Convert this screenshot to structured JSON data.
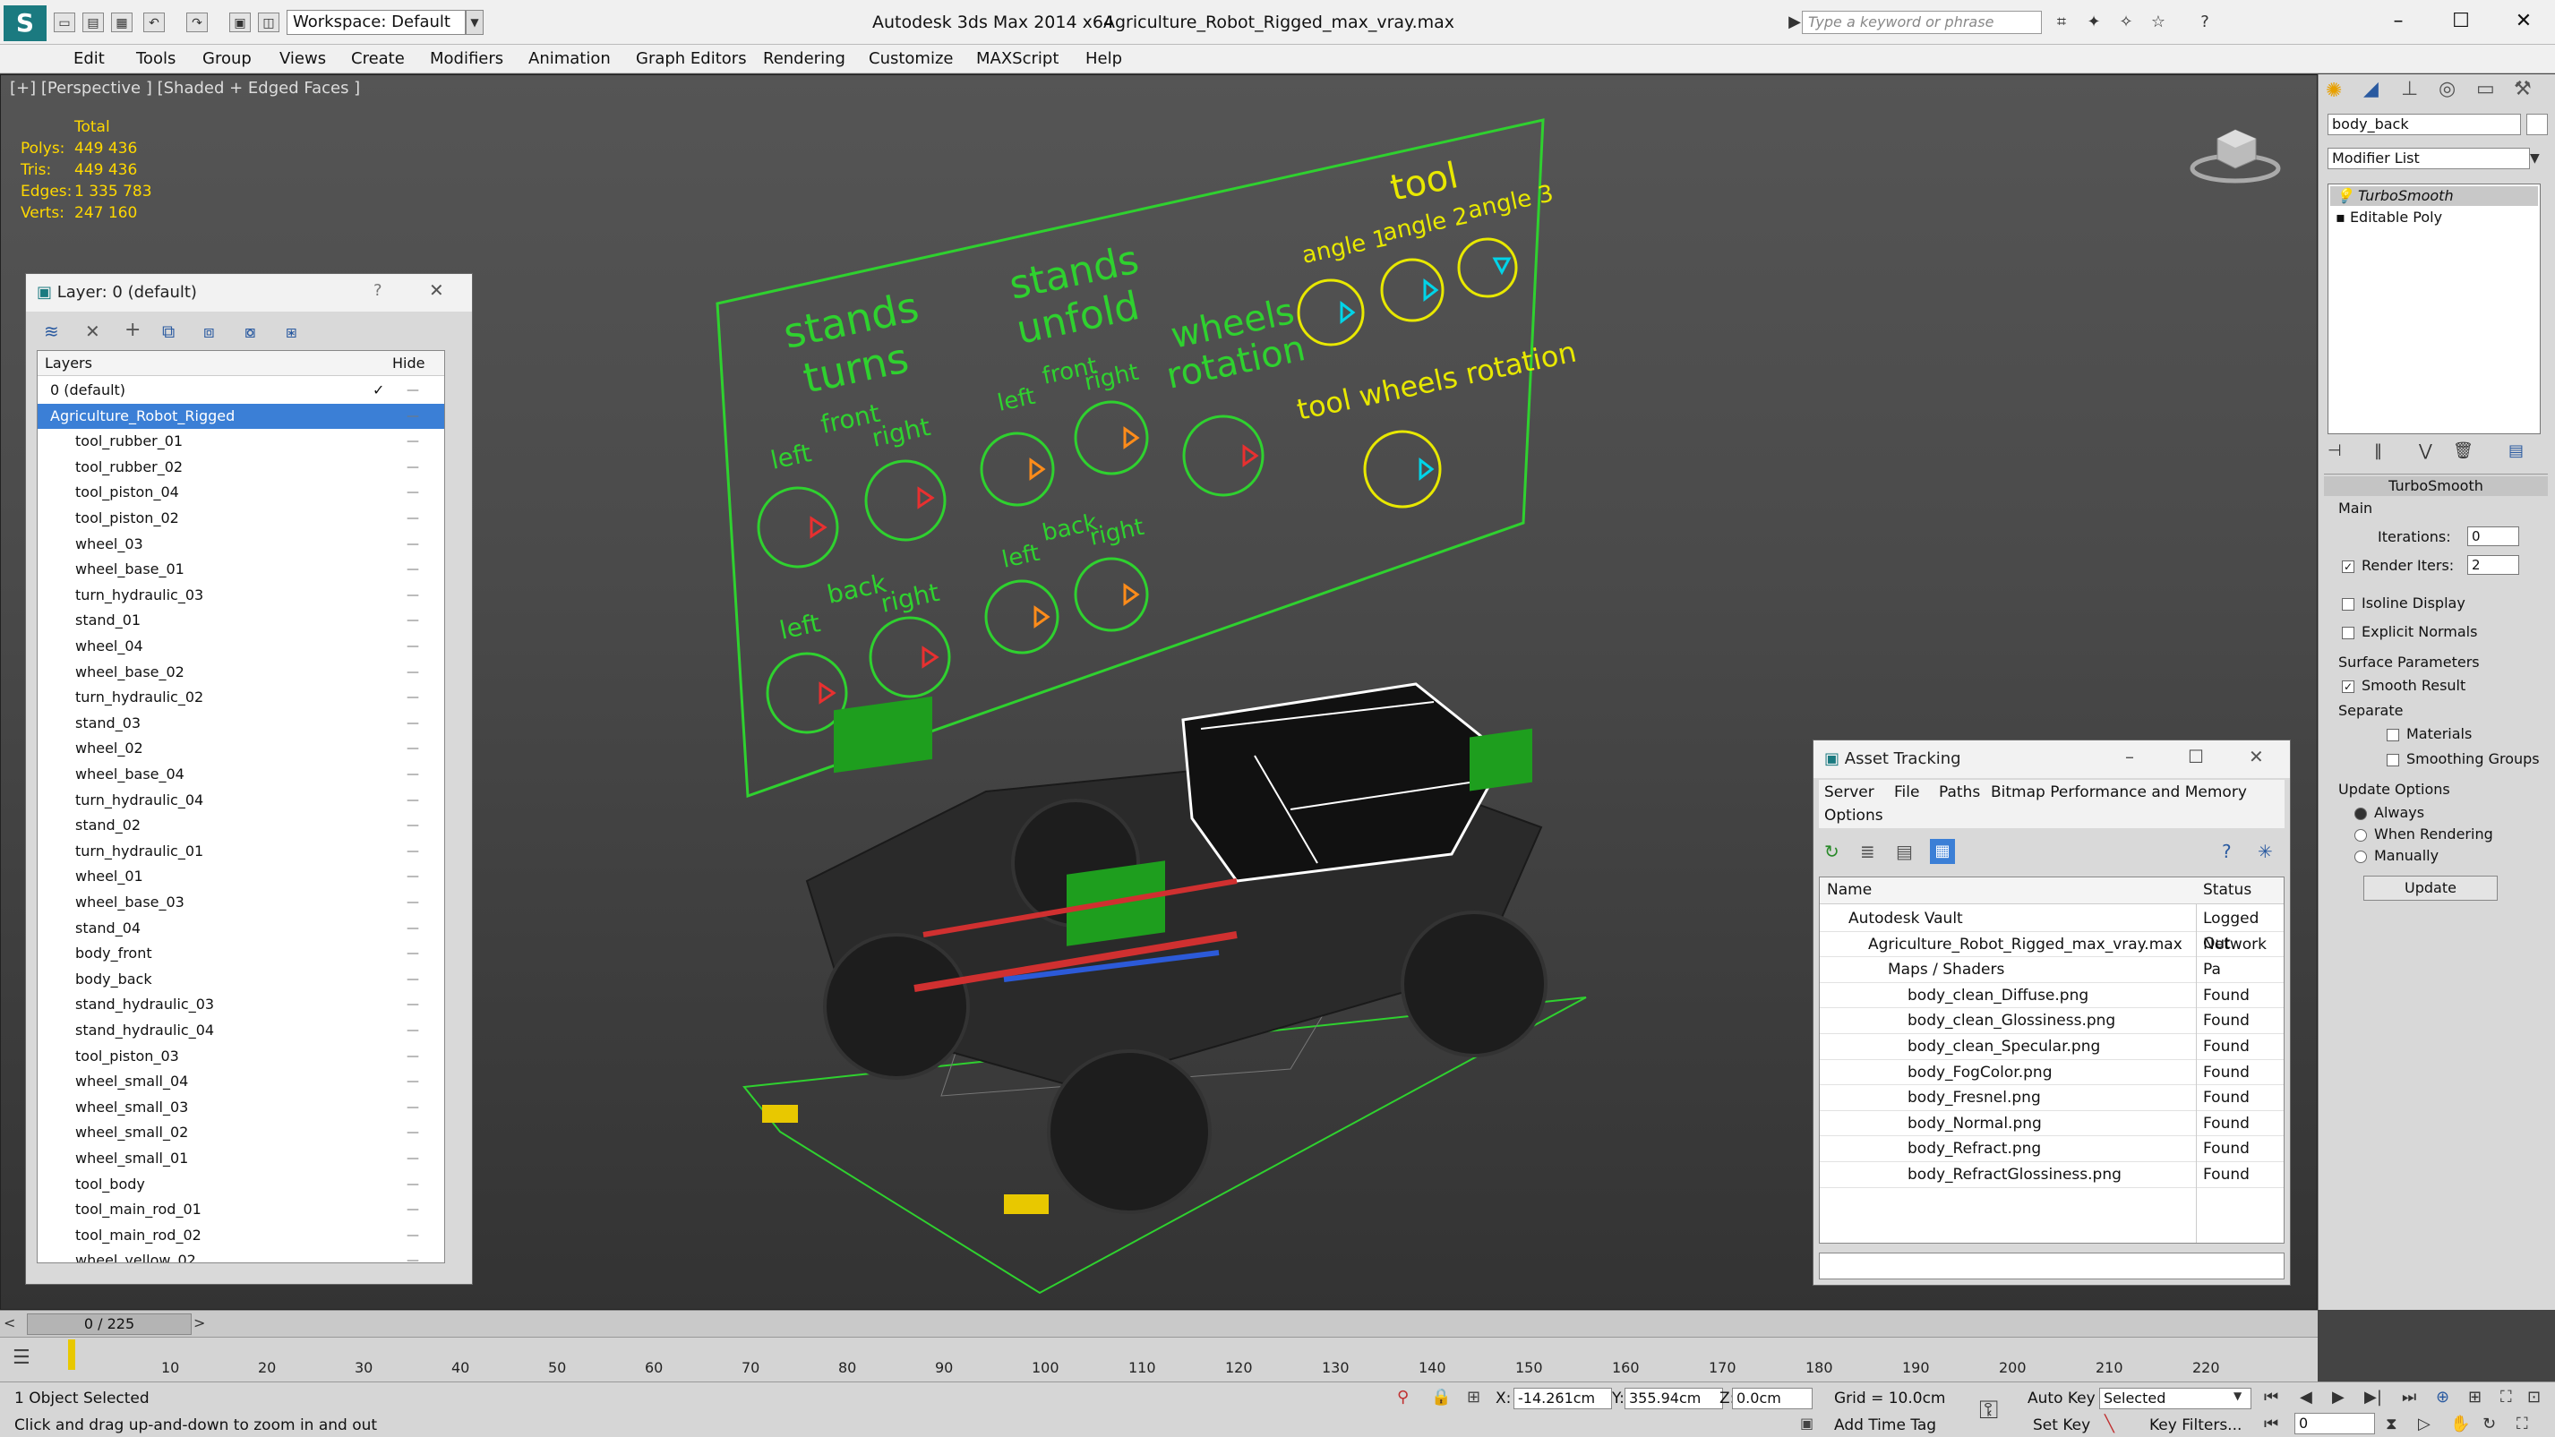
{
  "app": {
    "title": "Autodesk 3ds Max  2014 x64",
    "file": "Agriculture_Robot_Rigged_max_vray.max",
    "workspace": "Workspace: Default",
    "search_placeholder": "Type a keyword or phrase"
  },
  "menu": [
    "Edit",
    "Tools",
    "Group",
    "Views",
    "Create",
    "Modifiers",
    "Animation",
    "Graph Editors",
    "Rendering",
    "Customize",
    "MAXScript",
    "Help"
  ],
  "viewport": {
    "label": "[+] [Perspective ] [Shaded + Edged Faces ]",
    "stats": {
      "total": "Total",
      "rows": [
        {
          "label": "Polys:",
          "value": "449 436"
        },
        {
          "label": "Tris:",
          "value": "449 436"
        },
        {
          "label": "Edges:",
          "value": "1 335 783"
        },
        {
          "label": "Verts:",
          "value": "247 160"
        }
      ]
    },
    "board_labels": {
      "stands_turns_1": "stands",
      "stands_turns_2": "turns",
      "front": "front",
      "left_1": "left",
      "right_1": "right",
      "back": "back",
      "left_2": "left",
      "right_2": "right",
      "stands_unfold_1": "stands",
      "stands_unfold_2": "unfold",
      "front_2": "front",
      "left_3": "left",
      "right_3": "right",
      "back_2": "back",
      "left_4": "left",
      "right_4": "right",
      "wheels_1": "wheels",
      "wheels_2": "rotation",
      "tool": "tool",
      "angle1": "angle 1",
      "angle2": "angle 2",
      "angle3": "angle 3",
      "tool_wheels": "tool wheels rotation"
    },
    "colors": {
      "green": "#2fd12f",
      "yellow": "#e8e800",
      "cyan": "#00d4e8",
      "orange": "#ff8c1a",
      "red": "#e83030"
    }
  },
  "layers": {
    "title": "Layer: 0 (default)",
    "question": "?",
    "col_layers": "Layers",
    "col_hide": "Hide",
    "rows": [
      {
        "name": "0 (default)",
        "indent": 1,
        "check": "✓"
      },
      {
        "name": "Agriculture_Robot_Rigged",
        "indent": 1,
        "selected": true
      },
      {
        "name": "tool_rubber_01",
        "indent": 2
      },
      {
        "name": "tool_rubber_02",
        "indent": 2
      },
      {
        "name": "tool_piston_04",
        "indent": 2
      },
      {
        "name": "tool_piston_02",
        "indent": 2
      },
      {
        "name": "wheel_03",
        "indent": 2
      },
      {
        "name": "wheel_base_01",
        "indent": 2
      },
      {
        "name": "turn_hydraulic_03",
        "indent": 2
      },
      {
        "name": "stand_01",
        "indent": 2
      },
      {
        "name": "wheel_04",
        "indent": 2
      },
      {
        "name": "wheel_base_02",
        "indent": 2
      },
      {
        "name": "turn_hydraulic_02",
        "indent": 2
      },
      {
        "name": "stand_03",
        "indent": 2
      },
      {
        "name": "wheel_02",
        "indent": 2
      },
      {
        "name": "wheel_base_04",
        "indent": 2
      },
      {
        "name": "turn_hydraulic_04",
        "indent": 2
      },
      {
        "name": "stand_02",
        "indent": 2
      },
      {
        "name": "turn_hydraulic_01",
        "indent": 2
      },
      {
        "name": "wheel_01",
        "indent": 2
      },
      {
        "name": "wheel_base_03",
        "indent": 2
      },
      {
        "name": "stand_04",
        "indent": 2
      },
      {
        "name": "body_front",
        "indent": 2
      },
      {
        "name": "body_back",
        "indent": 2
      },
      {
        "name": "stand_hydraulic_03",
        "indent": 2
      },
      {
        "name": "stand_hydraulic_04",
        "indent": 2
      },
      {
        "name": "tool_piston_03",
        "indent": 2
      },
      {
        "name": "wheel_small_04",
        "indent": 2
      },
      {
        "name": "wheel_small_03",
        "indent": 2
      },
      {
        "name": "wheel_small_02",
        "indent": 2
      },
      {
        "name": "wheel_small_01",
        "indent": 2
      },
      {
        "name": "tool_body",
        "indent": 2
      },
      {
        "name": "tool_main_rod_01",
        "indent": 2
      },
      {
        "name": "tool_main_rod_02",
        "indent": 2
      },
      {
        "name": "wheel_yellow_02",
        "indent": 2
      }
    ]
  },
  "assets": {
    "title": "Asset Tracking",
    "menu": [
      "Server",
      "File",
      "Paths",
      "Bitmap Performance and Memory",
      "Options"
    ],
    "col_name": "Name",
    "col_status": "Status",
    "rows": [
      {
        "name": "Autodesk Vault",
        "status": "Logged Out",
        "indent": 1
      },
      {
        "name": "Agriculture_Robot_Rigged_max_vray.max",
        "status": "Network Pa",
        "indent": 2
      },
      {
        "name": "Maps / Shaders",
        "status": "",
        "indent": 3
      },
      {
        "name": "body_clean_Diffuse.png",
        "status": "Found",
        "indent": 4
      },
      {
        "name": "body_clean_Glossiness.png",
        "status": "Found",
        "indent": 4
      },
      {
        "name": "body_clean_Specular.png",
        "status": "Found",
        "indent": 4
      },
      {
        "name": "body_FogColor.png",
        "status": "Found",
        "indent": 4
      },
      {
        "name": "body_Fresnel.png",
        "status": "Found",
        "indent": 4
      },
      {
        "name": "body_Normal.png",
        "status": "Found",
        "indent": 4
      },
      {
        "name": "body_Refract.png",
        "status": "Found",
        "indent": 4
      },
      {
        "name": "body_RefractGlossiness.png",
        "status": "Found",
        "indent": 4
      }
    ]
  },
  "command": {
    "object_name": "body_back",
    "modifier_list": "Modifier List",
    "stack": [
      "TurboSmooth",
      "Editable Poly"
    ],
    "rollout": "TurboSmooth",
    "main": "Main",
    "iterations_label": "Iterations:",
    "iterations": "0",
    "render_iters_label": "Render Iters:",
    "render_iters": "2",
    "isoline": "Isoline Display",
    "explicit": "Explicit Normals",
    "surface": "Surface Parameters",
    "smooth": "Smooth Result",
    "separate": "Separate",
    "materials": "Materials",
    "smoothing": "Smoothing Groups",
    "update_opts": "Update Options",
    "always": "Always",
    "when_rendering": "When Rendering",
    "manually": "Manually",
    "update": "Update"
  },
  "timeline": {
    "frame": "0 / 225",
    "ticks": [
      "10",
      "20",
      "30",
      "40",
      "50",
      "60",
      "70",
      "80",
      "90",
      "100",
      "110",
      "120",
      "130",
      "140",
      "150",
      "160",
      "170",
      "180",
      "190",
      "200",
      "210",
      "220"
    ]
  },
  "status": {
    "selected": "1 Object Selected",
    "hint": "Click and drag up-and-down to zoom in and out",
    "x_label": "X:",
    "x": "-14.261cm",
    "y_label": "Y:",
    "y": "355.94cm",
    "z_label": "Z:",
    "z": "0.0cm",
    "grid": "Grid = 10.0cm",
    "add_time_tag": "Add Time Tag",
    "auto_key": "Auto Key",
    "set_key": "Set Key",
    "selected_dd": "Selected",
    "key_filters": "Key Filters...",
    "frame_field": "0"
  }
}
